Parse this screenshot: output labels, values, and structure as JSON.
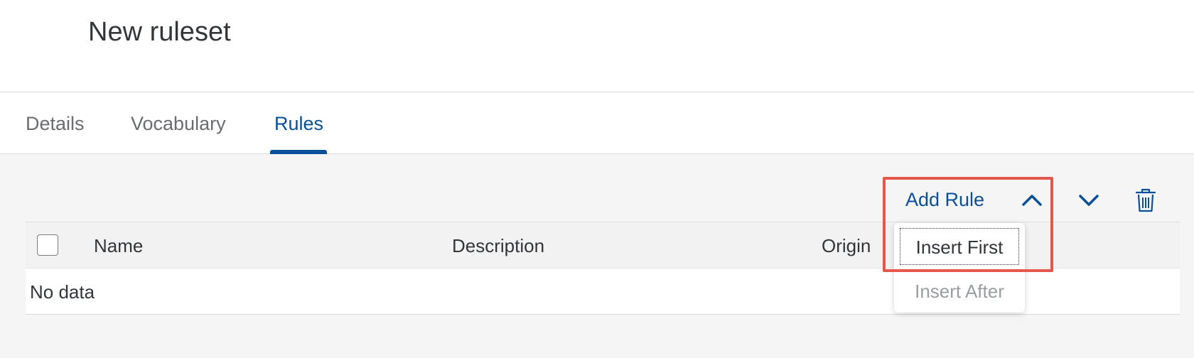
{
  "header": {
    "title": "New ruleset"
  },
  "tabs": [
    {
      "label": "Details"
    },
    {
      "label": "Vocabulary"
    },
    {
      "label": "Rules",
      "active": true
    }
  ],
  "toolbar": {
    "add_rule_label": "Add Rule",
    "expand_icon": "chevron-up-icon",
    "move_down_icon": "chevron-down-icon",
    "delete_icon": "trash-icon"
  },
  "table": {
    "columns": [
      "Name",
      "Description",
      "Origin"
    ],
    "empty_text": "No data"
  },
  "dropdown": {
    "items": [
      {
        "label": "Insert First",
        "focused": true
      },
      {
        "label": "Insert After",
        "disabled": true
      }
    ]
  },
  "colors": {
    "accent": "#0a4f99",
    "highlight": "#e5564b",
    "text": "#32363a",
    "muted": "#6a6d70"
  }
}
